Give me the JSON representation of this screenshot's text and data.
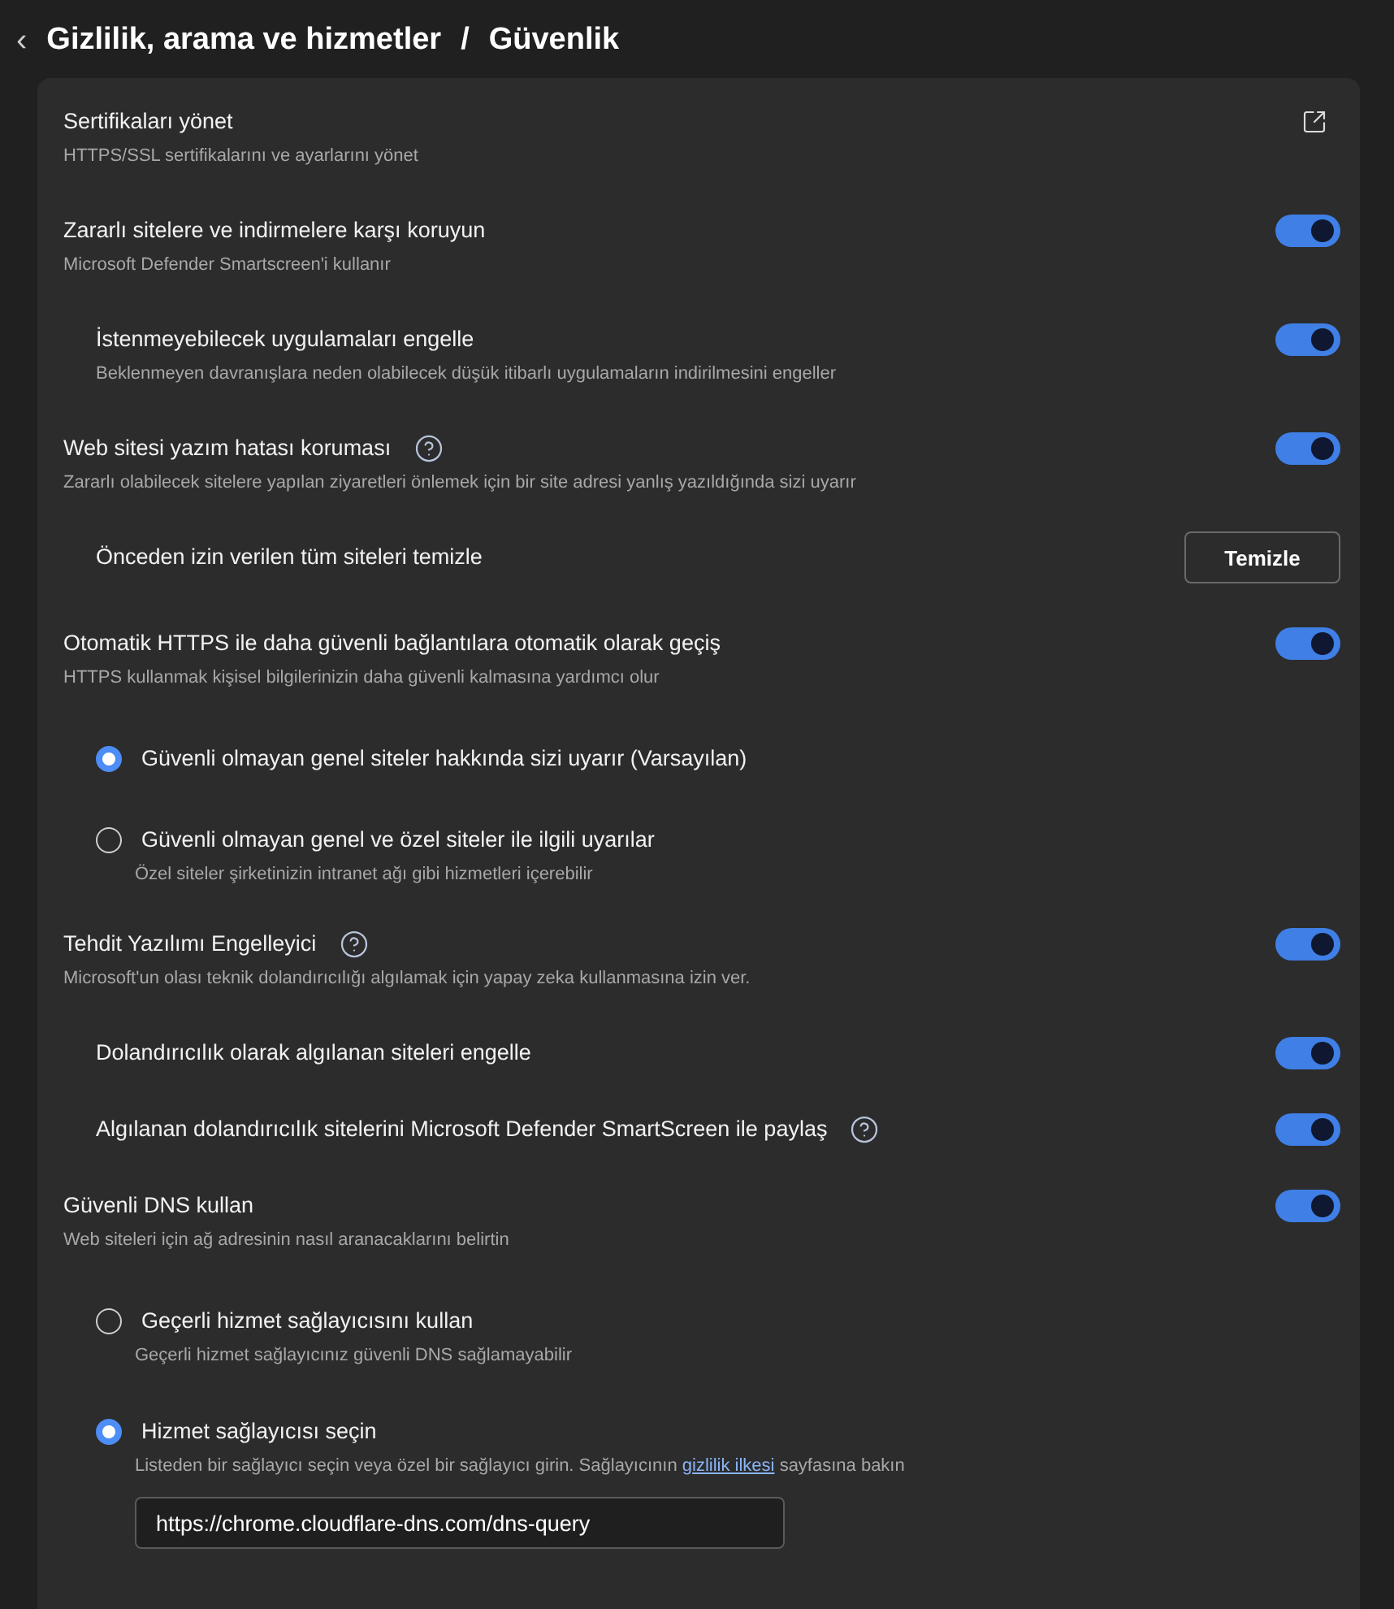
{
  "header": {
    "back": "‹",
    "crumbs": [
      "Gizlilik, arama ve hizmetler",
      "Güvenlik"
    ],
    "separator": "/"
  },
  "items": [
    {
      "kind": "link",
      "title": "Sertifikaları yönet",
      "description": "HTTPS/SSL sertifikalarını ve ayarlarını yönet"
    },
    {
      "kind": "toggle",
      "title": "Zararlı sitelere ve indirmelere karşı koruyun",
      "description": "Microsoft Defender Smartscreen'i kullanır",
      "on": true,
      "children": [
        {
          "kind": "toggle",
          "title": "İstenmeyebilecek uygulamaları engelle",
          "description": "Beklenmeyen davranışlara neden olabilecek düşük itibarlı uygulamaların indirilmesini engeller",
          "on": true
        }
      ]
    },
    {
      "kind": "toggle",
      "title": "Web sitesi yazım hatası koruması",
      "help": true,
      "description": "Zararlı olabilecek sitelere yapılan ziyaretleri önlemek için bir site adresi yanlış yazıldığında sizi uyarır",
      "on": true,
      "children": [
        {
          "kind": "button",
          "title": "Önceden izin verilen tüm siteleri temizle",
          "button": "Temizle"
        }
      ]
    },
    {
      "kind": "toggle",
      "title": "Otomatik HTTPS ile daha güvenli bağlantılara otomatik olarak geçiş",
      "description": "HTTPS kullanmak kişisel bilgilerinizin daha güvenli kalmasına yardımcı olur",
      "on": true,
      "children": [
        {
          "kind": "radio",
          "title": "Güvenli olmayan genel siteler hakkında sizi uyarır (Varsayılan)",
          "selected": true
        },
        {
          "kind": "radio",
          "title": "Güvenli olmayan genel ve özel siteler ile ilgili uyarılar",
          "description": "Özel siteler şirketinizin intranet ağı gibi hizmetleri içerebilir",
          "selected": false
        }
      ]
    },
    {
      "kind": "toggle",
      "title": "Tehdit Yazılımı Engelleyici",
      "help": true,
      "description": "Microsoft'un olası teknik dolandırıcılığı algılamak için yapay zeka kullanmasına izin ver.",
      "on": true,
      "children": [
        {
          "kind": "toggle",
          "title": "Dolandırıcılık olarak algılanan siteleri engelle",
          "on": true
        },
        {
          "kind": "toggle",
          "title": "Algılanan dolandırıcılık sitelerini Microsoft Defender SmartScreen ile paylaş",
          "help": true,
          "on": true
        }
      ]
    },
    {
      "kind": "toggle",
      "title": "Güvenli DNS kullan",
      "description": "Web siteleri için ağ adresinin nasıl aranacaklarını belirtin",
      "on": true,
      "children": [
        {
          "kind": "radio",
          "title": "Geçerli hizmet sağlayıcısını kullan",
          "description": "Geçerli hizmet sağlayıcınız güvenli DNS sağlamayabilir",
          "selected": false
        },
        {
          "kind": "radio",
          "title": "Hizmet sağlayıcısı seçin",
          "description": "Listeden bir sağlayıcı seçin veya özel bir sağlayıcı girin. Sağlayıcının",
          "link": "gizlilik ilkesi",
          "description_after": "sayfasına bakın",
          "field": "https://chrome.cloudflare-dns.com/dns-query",
          "selected": true
        }
      ]
    }
  ]
}
